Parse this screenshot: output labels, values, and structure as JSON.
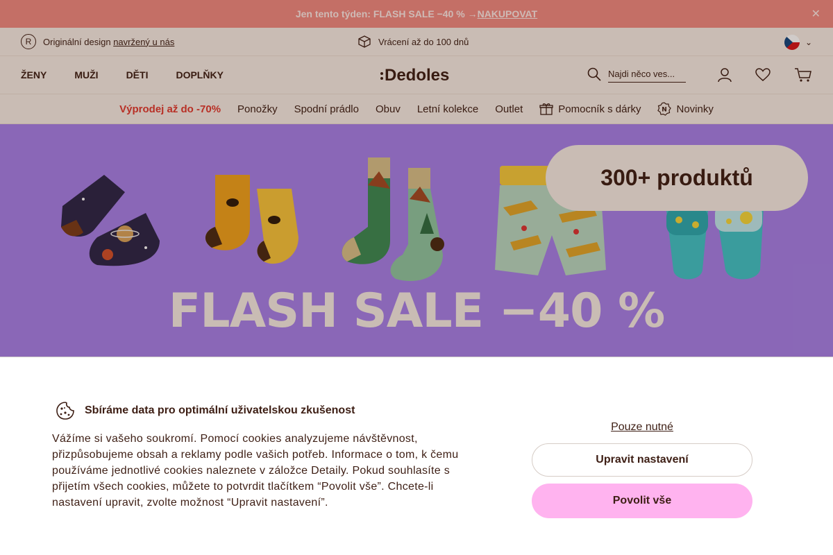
{
  "promo": {
    "text": "Jen tento týden: FLASH SALE −40 % →",
    "link": "NAKUPOVAT",
    "close": "✕"
  },
  "usp": {
    "original_prefix": "Originální design",
    "original_link": "navržený u nás",
    "returns": "Vrácení až do 100 dnů"
  },
  "header": {
    "nav": [
      "ŽENY",
      "MUŽI",
      "DĚTI",
      "DOPLŇKY"
    ],
    "logo": "Dedoles",
    "search_placeholder": "Najdi něco ves..."
  },
  "catnav": {
    "sale": "Výprodej až do -70%",
    "items": [
      "Ponožky",
      "Spodní prádlo",
      "Obuv",
      "Letní kolekce",
      "Outlet"
    ],
    "gift": "Pomocník s dárky",
    "new": "Novinky"
  },
  "hero": {
    "badge": "300+ produktů",
    "title": "FLASH SALE −40 %"
  },
  "cookie": {
    "title": "Sbíráme data pro optimální uživatelskou zkušenost",
    "text": "Vážíme si vašeho soukromí. Pomocí cookies analyzujeme návštěvnost, přizpůsobujeme obsah a reklamy podle vašich potřeb. Informace o tom, k čemu používáme jednotlivé cookies naleznete v záložce Detaily. Pokud souhlasíte s přijetím všech cookies, můžete to potvrdit tlačítkem “Povolit vše”. Chcete-li nastavení upravit, zvolte možnost “Upravit nastavení”.",
    "necessary": "Pouze nutné",
    "settings": "Upravit nastavení",
    "accept": "Povolit vše"
  },
  "colors": {
    "promo": "#f08a80",
    "cream": "#f6ece4",
    "hero": "#a67fe8",
    "accent_pink": "#ffb3ef",
    "text": "#3d1e14",
    "sale_red": "#e0382e"
  }
}
